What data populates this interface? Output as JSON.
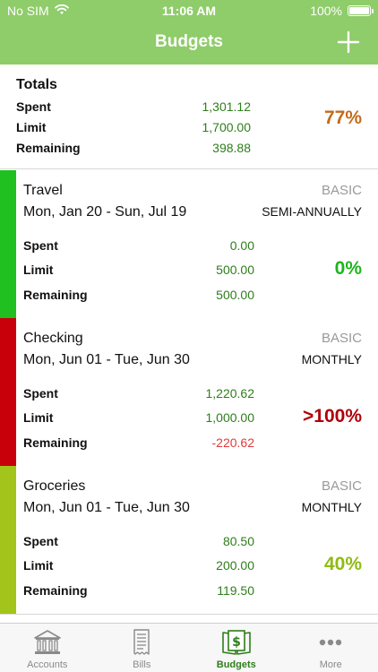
{
  "status": {
    "carrier": "No SIM",
    "time": "11:06 AM",
    "battery": "100%"
  },
  "nav": {
    "title": "Budgets"
  },
  "totals": {
    "heading": "Totals",
    "spent_label": "Spent",
    "limit_label": "Limit",
    "remaining_label": "Remaining",
    "spent": "1,301.12",
    "limit": "1,700.00",
    "remaining": "398.88",
    "percent": "77%"
  },
  "budgets": [
    {
      "name": "Travel",
      "dates": "Mon, Jan 20 - Sun, Jul 19",
      "type": "BASIC",
      "period": "SEMI-ANNUALLY",
      "spent_label": "Spent",
      "limit_label": "Limit",
      "remaining_label": "Remaining",
      "spent": "0.00",
      "limit": "500.00",
      "remaining": "500.00",
      "percent": "0%",
      "stripe_color": "#1fc01f",
      "percent_color": "#1fb41f",
      "remaining_color": "#2f7d1b"
    },
    {
      "name": "Checking",
      "dates": "Mon, Jun 01 - Tue, Jun 30",
      "type": "BASIC",
      "period": "MONTHLY",
      "spent_label": "Spent",
      "limit_label": "Limit",
      "remaining_label": "Remaining",
      "spent": "1,220.62",
      "limit": "1,000.00",
      "remaining": "-220.62",
      "percent": ">100%",
      "stripe_color": "#c8000a",
      "percent_color": "#b0000a",
      "remaining_color": "#e03a3a"
    },
    {
      "name": "Groceries",
      "dates": "Mon, Jun 01 - Tue, Jun 30",
      "type": "BASIC",
      "period": "MONTHLY",
      "spent_label": "Spent",
      "limit_label": "Limit",
      "remaining_label": "Remaining",
      "spent": "80.50",
      "limit": "200.00",
      "remaining": "119.50",
      "percent": "40%",
      "stripe_color": "#a3c41a",
      "percent_color": "#8fbb12",
      "remaining_color": "#2f7d1b"
    }
  ],
  "tabs": [
    {
      "label": "Accounts",
      "icon": "bank-icon",
      "active": false
    },
    {
      "label": "Bills",
      "icon": "receipt-icon",
      "active": false
    },
    {
      "label": "Budgets",
      "icon": "budget-book-icon",
      "active": true
    },
    {
      "label": "More",
      "icon": "more-dots-icon",
      "active": false
    }
  ],
  "colors": {
    "header_green": "#8fcc6a",
    "value_green": "#2f7d1b",
    "totals_percent": "#c46a1a"
  }
}
